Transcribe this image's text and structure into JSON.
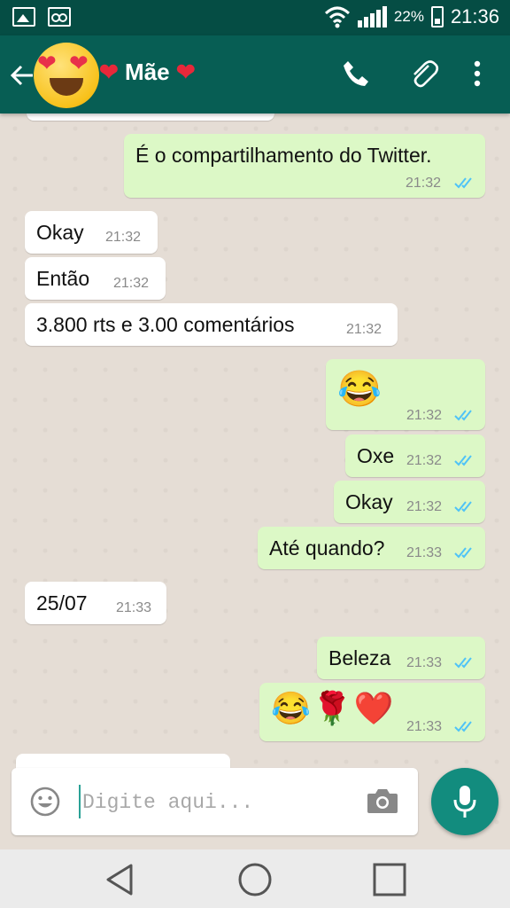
{
  "status_bar": {
    "battery": "22%",
    "time": "21:36"
  },
  "header": {
    "contact_name": "Mãe",
    "heart": "❤"
  },
  "messages": [
    {
      "dir": "out",
      "text": "É o compartilhamento do Twitter.",
      "time": "21:32"
    },
    {
      "dir": "in",
      "text": "Okay",
      "time": "21:32"
    },
    {
      "dir": "in",
      "text": "Então",
      "time": "21:32"
    },
    {
      "dir": "in",
      "text": "3.800 rts e 3.00 comentários",
      "time": "21:32"
    },
    {
      "dir": "out",
      "text": "😂",
      "time": "21:32"
    },
    {
      "dir": "out",
      "text": "Oxe",
      "time": "21:32"
    },
    {
      "dir": "out",
      "text": "Okay",
      "time": "21:32"
    },
    {
      "dir": "out",
      "text": "Até quando?",
      "time": "21:33"
    },
    {
      "dir": "in",
      "text": "25/07",
      "time": "21:33"
    },
    {
      "dir": "out",
      "text": "Beleza",
      "time": "21:33"
    },
    {
      "dir": "out",
      "text": "😂🌹❤️",
      "time": "21:33"
    }
  ],
  "composer": {
    "placeholder": "Digite aqui..."
  },
  "colors": {
    "header": "#075e54",
    "status_bar": "#054d44",
    "outgoing": "#dcf8c6",
    "incoming": "#ffffff",
    "tick_read": "#4fc3f7",
    "fab": "#128c7e"
  },
  "icons": [
    "back-arrow-icon",
    "call-icon",
    "attach-icon",
    "more-icon",
    "emoji-icon",
    "camera-icon",
    "mic-icon",
    "nav-back-icon",
    "nav-home-icon",
    "nav-recent-icon"
  ]
}
